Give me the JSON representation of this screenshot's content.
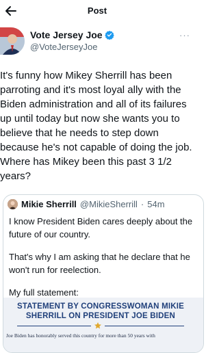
{
  "header": {
    "title": "Post",
    "back_icon": "arrow-left-icon"
  },
  "author": {
    "name": "Vote Jersey Joe",
    "handle": "@VoteJerseyJoe",
    "verified": true,
    "verified_color": "#1d9bf0"
  },
  "more_label": "···",
  "post": {
    "text": "It's funny how Mikey Sherrill has been parroting and it's most loyal ally with the Biden administration and all of its failures up until today but now she wants you to believe that he needs to step down because he's not capable of doing the job. Where has Mikey been this past 3 1/2 years?"
  },
  "quote": {
    "name": "Mikie Sherrill",
    "handle": "@MikieSherrill",
    "separator": "·",
    "time": "54m",
    "paragraphs": [
      "I know President Biden cares deeply about the future of our country.",
      "That's why I am asking that he declare that he won't run for reelection.",
      "My full statement:"
    ],
    "statement": {
      "title_line1": "STATEMENT BY CONGRESSWOMAN MIKIE",
      "title_line2": "SHERRILL ON PRESIDENT JOE BIDEN",
      "body": "Joe Biden has honorably served this country for more than 50 years with",
      "accent_color": "#1f3f7a",
      "star_color": "#e0a82e"
    }
  }
}
